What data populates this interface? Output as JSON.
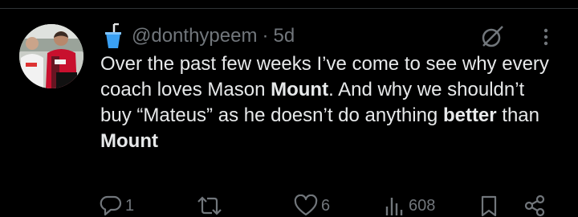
{
  "tweet": {
    "author_handle": "@donthypeem",
    "separator": "·",
    "timestamp": "5d",
    "text_segments": [
      "Over the past few weeks I’ve come to see why every coach loves Mason ",
      "Mount",
      ". And why we shouldn’t buy “Mateus” as he doesn’t do anything ",
      "better",
      " than ",
      "Mount"
    ]
  },
  "actions": {
    "reply_count": "1",
    "repost_count": "",
    "like_count": "6",
    "views_count": "608"
  },
  "icons": {
    "author_emoji": "cup-with-straw-icon",
    "grok": "grok-icon",
    "more": "more-icon",
    "reply": "reply-icon",
    "repost": "repost-icon",
    "like": "heart-icon",
    "views": "views-icon",
    "bookmark": "bookmark-icon",
    "share": "share-icon"
  },
  "colors": {
    "background": "#000000",
    "text": "#e7e9ea",
    "secondary": "#71767b",
    "emoji_cup": "#3aa0f3"
  }
}
